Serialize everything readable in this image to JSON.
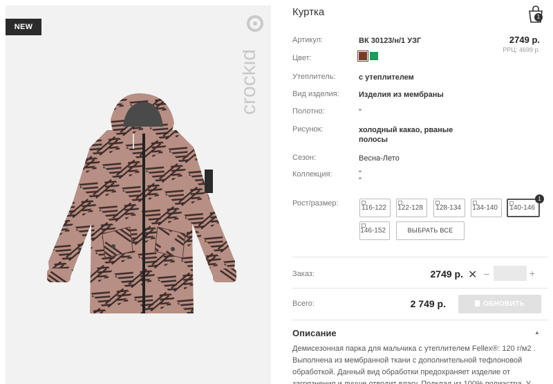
{
  "badge": "NEW",
  "brand": "crockid",
  "product": {
    "title": "Куртка",
    "price": "2749 р.",
    "rrp": "РРЦ: 4699 р."
  },
  "cart": {
    "count": "1"
  },
  "specs": [
    {
      "label": "Артикул:",
      "value": "ВК 30123/н/1 УЗГ"
    },
    {
      "label": "Цвет:",
      "value": ""
    },
    {
      "label": "Утеплитель:",
      "value": "с утеплителем"
    },
    {
      "label": "Вид изделия:",
      "value": "Изделия из мембраны"
    },
    {
      "label": "Полотно:",
      "value": "\""
    },
    {
      "label": "Рисунок:",
      "value": "холодный какао, рваные полосы"
    },
    {
      "label": "Сезон:",
      "value": "Весна-Лето"
    },
    {
      "label": "Коллекция:",
      "value": "\"\n\""
    }
  ],
  "colors": [
    "#7a3a2a",
    "#1e9a5a"
  ],
  "sizes": {
    "label": "Рост/размер:",
    "options": [
      "116-122",
      "122-128",
      "128-134",
      "134-140",
      "140-146",
      "146-152"
    ],
    "selected": "140-146",
    "selected_count": "1",
    "select_all": "ВЫБРАТЬ ВСЕ"
  },
  "order": {
    "label": "Заказ:",
    "price": "2749 р.",
    "remove": "✕",
    "minus": "–",
    "plus": "+"
  },
  "total": {
    "label": "Всего:",
    "price": "2 749 р.",
    "update_label": "ОБНОВИТЬ"
  },
  "description": {
    "title": "Описание",
    "toggle": "▲",
    "text": "Демисезонная парка для мальчика с утеплителем Fellex®: 120 г/м2 . Выполнена из мембранной ткани с дополнительной тефлоновой обработкой. Данный вид обработки предохраняет изделие от загрязнения и лучше отводит влагу. Подклад из 100% полиэстра. У"
  }
}
